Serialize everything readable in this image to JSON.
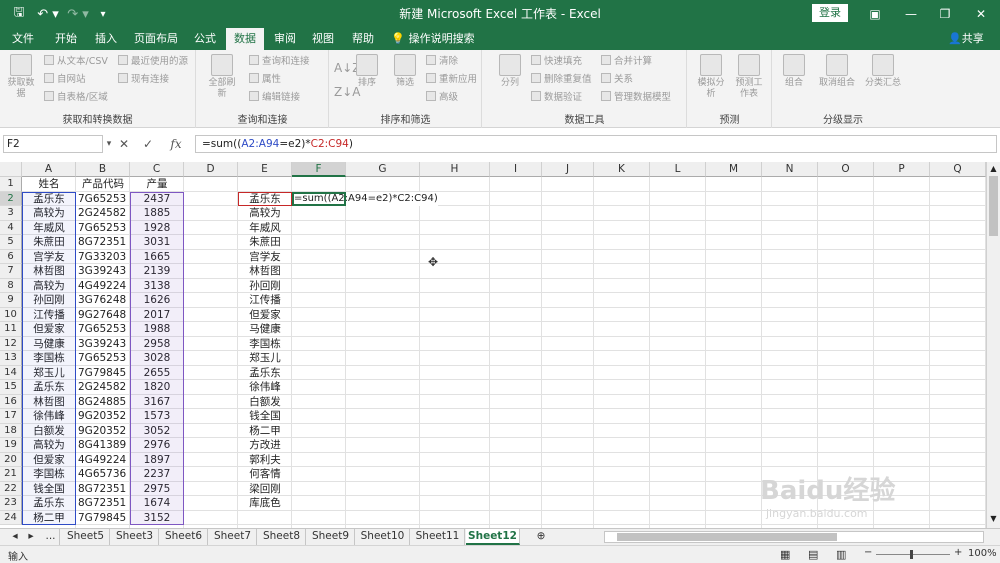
{
  "window": {
    "title": "新建 Microsoft Excel 工作表 - Excel",
    "login": "登录"
  },
  "menu": {
    "tabs": [
      "文件",
      "开始",
      "插入",
      "页面布局",
      "公式",
      "数据",
      "审阅",
      "视图",
      "帮助"
    ],
    "active": 5,
    "tell_me": "操作说明搜索",
    "share": "共享"
  },
  "ribbon": {
    "groups": [
      "获取和转换数据",
      "查询和连接",
      "排序和筛选",
      "数据工具",
      "预测",
      "分级显示"
    ],
    "get_data": {
      "big": "获取数据",
      "items": [
        "从文本/CSV",
        "自网站",
        "自表格/区域",
        "最近使用的源",
        "现有连接"
      ]
    },
    "queries": {
      "big": "全部刷新",
      "items": [
        "查询和连接",
        "属性",
        "编辑链接"
      ]
    },
    "sort": {
      "sort": "排序",
      "filter": "筛选",
      "items": [
        "清除",
        "重新应用",
        "高级"
      ]
    },
    "tools": {
      "big": "分列",
      "items": [
        "快速填充",
        "删除重复值",
        "数据验证",
        "合并计算",
        "关系",
        "管理数据模型"
      ]
    },
    "forecast": {
      "what_if": "模拟分析",
      "sheet": "预测工作表"
    },
    "outline": {
      "items": [
        "组合",
        "取消组合",
        "分类汇总"
      ]
    }
  },
  "formula_bar": {
    "name_box": "F2",
    "fx": "fx",
    "formula_parts": [
      "=sum((",
      "A2:A94",
      "=e2)*",
      "C2:C94",
      ")"
    ]
  },
  "columns": [
    "A",
    "B",
    "C",
    "D",
    "E",
    "F",
    "G",
    "H",
    "I",
    "J",
    "K",
    "L",
    "M",
    "N",
    "O",
    "P",
    "Q"
  ],
  "selected_column": "F",
  "rows": [
    {
      "n": "1",
      "a": "姓名",
      "b": "产品代码",
      "c": "产量",
      "e": ""
    },
    {
      "n": "2",
      "a": "孟乐东",
      "b": "7G65253",
      "c": "2437",
      "e": "孟乐东"
    },
    {
      "n": "3",
      "a": "高较为",
      "b": "2G24582",
      "c": "1885",
      "e": "高较为"
    },
    {
      "n": "4",
      "a": "年威风",
      "b": "7G65253",
      "c": "1928",
      "e": "年威风"
    },
    {
      "n": "5",
      "a": "朱蔗田",
      "b": "8G72351",
      "c": "3031",
      "e": "朱蔗田"
    },
    {
      "n": "6",
      "a": "宫学友",
      "b": "7G33203",
      "c": "1665",
      "e": "宫学友"
    },
    {
      "n": "7",
      "a": "林哲图",
      "b": "3G39243",
      "c": "2139",
      "e": "林哲图"
    },
    {
      "n": "8",
      "a": "高较为",
      "b": "4G49224",
      "c": "3138",
      "e": "孙回刚"
    },
    {
      "n": "9",
      "a": "孙回刚",
      "b": "3G76248",
      "c": "1626",
      "e": "江传播"
    },
    {
      "n": "10",
      "a": "江传播",
      "b": "9G27648",
      "c": "2017",
      "e": "但爱家"
    },
    {
      "n": "11",
      "a": "但爱家",
      "b": "7G65253",
      "c": "1988",
      "e": "马健康"
    },
    {
      "n": "12",
      "a": "马健康",
      "b": "3G39243",
      "c": "2958",
      "e": "李国栋"
    },
    {
      "n": "13",
      "a": "李国栋",
      "b": "7G65253",
      "c": "3028",
      "e": "郑玉儿"
    },
    {
      "n": "14",
      "a": "郑玉儿",
      "b": "7G79845",
      "c": "2655",
      "e": "孟乐东"
    },
    {
      "n": "15",
      "a": "孟乐东",
      "b": "2G24582",
      "c": "1820",
      "e": "徐伟峰"
    },
    {
      "n": "16",
      "a": "林哲图",
      "b": "8G24885",
      "c": "3167",
      "e": "白额发"
    },
    {
      "n": "17",
      "a": "徐伟峰",
      "b": "9G20352",
      "c": "1573",
      "e": "钱全国"
    },
    {
      "n": "18",
      "a": "白额发",
      "b": "9G20352",
      "c": "3052",
      "e": "杨二甲"
    },
    {
      "n": "19",
      "a": "高较为",
      "b": "8G41389",
      "c": "2976",
      "e": "方改进"
    },
    {
      "n": "20",
      "a": "但爱家",
      "b": "4G49224",
      "c": "1897",
      "e": "郭利夫"
    },
    {
      "n": "21",
      "a": "李国栋",
      "b": "4G65736",
      "c": "2237",
      "e": "何客情"
    },
    {
      "n": "22",
      "a": "钱全国",
      "b": "8G72351",
      "c": "2975",
      "e": "梁回刚"
    },
    {
      "n": "23",
      "a": "孟乐东",
      "b": "8G72351",
      "c": "1674",
      "e": "库底色"
    },
    {
      "n": "24",
      "a": "杨二甲",
      "b": "7G79845",
      "c": "3152",
      "e": ""
    }
  ],
  "f2_text": "=sum((A2:A94=e2)*C2:C94)",
  "sheets": [
    "Sheet5",
    "Sheet3",
    "Sheet6",
    "Sheet7",
    "Sheet8",
    "Sheet9",
    "Sheet10",
    "Sheet11",
    "Sheet12"
  ],
  "active_sheet": "Sheet12",
  "status": {
    "mode": "输入",
    "zoom": "100%"
  },
  "watermark": "Baidu经验",
  "watermark_sub": "jingyan.baidu.com"
}
